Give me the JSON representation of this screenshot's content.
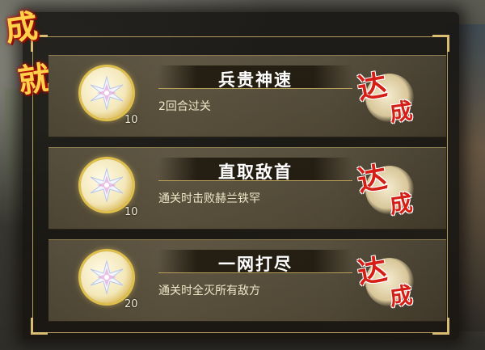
{
  "title": {
    "char1": "成",
    "char2": "就"
  },
  "achievements": [
    {
      "name": "兵贵神速",
      "description": "2回合过关",
      "reward_count": "10",
      "status": {
        "char1": "达",
        "char2": "成"
      }
    },
    {
      "name": "直取敌首",
      "description": "通关时击败赫兰铁罕",
      "reward_count": "10",
      "status": {
        "char1": "达",
        "char2": "成"
      }
    },
    {
      "name": "一网打尽",
      "description": "通关时全灭所有敌方",
      "reward_count": "20",
      "status": {
        "char1": "达",
        "char2": "成"
      }
    }
  ],
  "colors": {
    "accent_gold": "#d9bd72",
    "stamp_red": "#d41e16",
    "title_yellow": "#ffd24a"
  },
  "icons": {
    "reward": "crystal-star-medal-icon",
    "stamp": "completed-stamp-icon"
  }
}
